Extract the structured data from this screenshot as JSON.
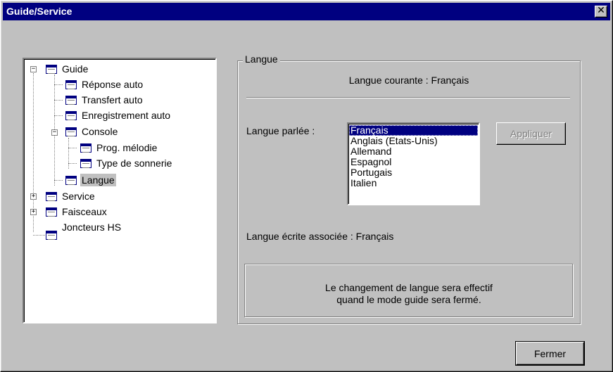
{
  "window": {
    "title": "Guide/Service",
    "close_symbol": "✕"
  },
  "tree": {
    "guide": "Guide",
    "reponse_auto": "Réponse auto",
    "transfert_auto": "Transfert auto",
    "enregistrement_auto": "Enregistrement auto",
    "console": "Console",
    "prog_melodie": "Prog. mélodie",
    "type_sonnerie": "Type de sonnerie",
    "langue": "Langue",
    "service": "Service",
    "faisceaux": "Faisceaux",
    "joncteurs_hs": "Joncteurs HS",
    "expanded_symbol": "−",
    "collapsed_symbol": "+"
  },
  "panel": {
    "group_title": "Langue",
    "current_language": "Langue courante : Français",
    "spoken_label": "Langue parlée :",
    "languages": [
      "Français",
      "Anglais (Etats-Unis)",
      "Allemand",
      "Espagnol",
      "Portugais",
      "Italien"
    ],
    "apply_label": "Appliquer",
    "written_label": "Langue écrite associée : Français",
    "notice_line1": "Le changement de langue sera effectif",
    "notice_line2": "quand le mode guide sera fermé."
  },
  "footer": {
    "close_label": "Fermer"
  },
  "colors": {
    "title_bar": "#000080",
    "face": "#c0c0c0",
    "selection": "#000080"
  }
}
